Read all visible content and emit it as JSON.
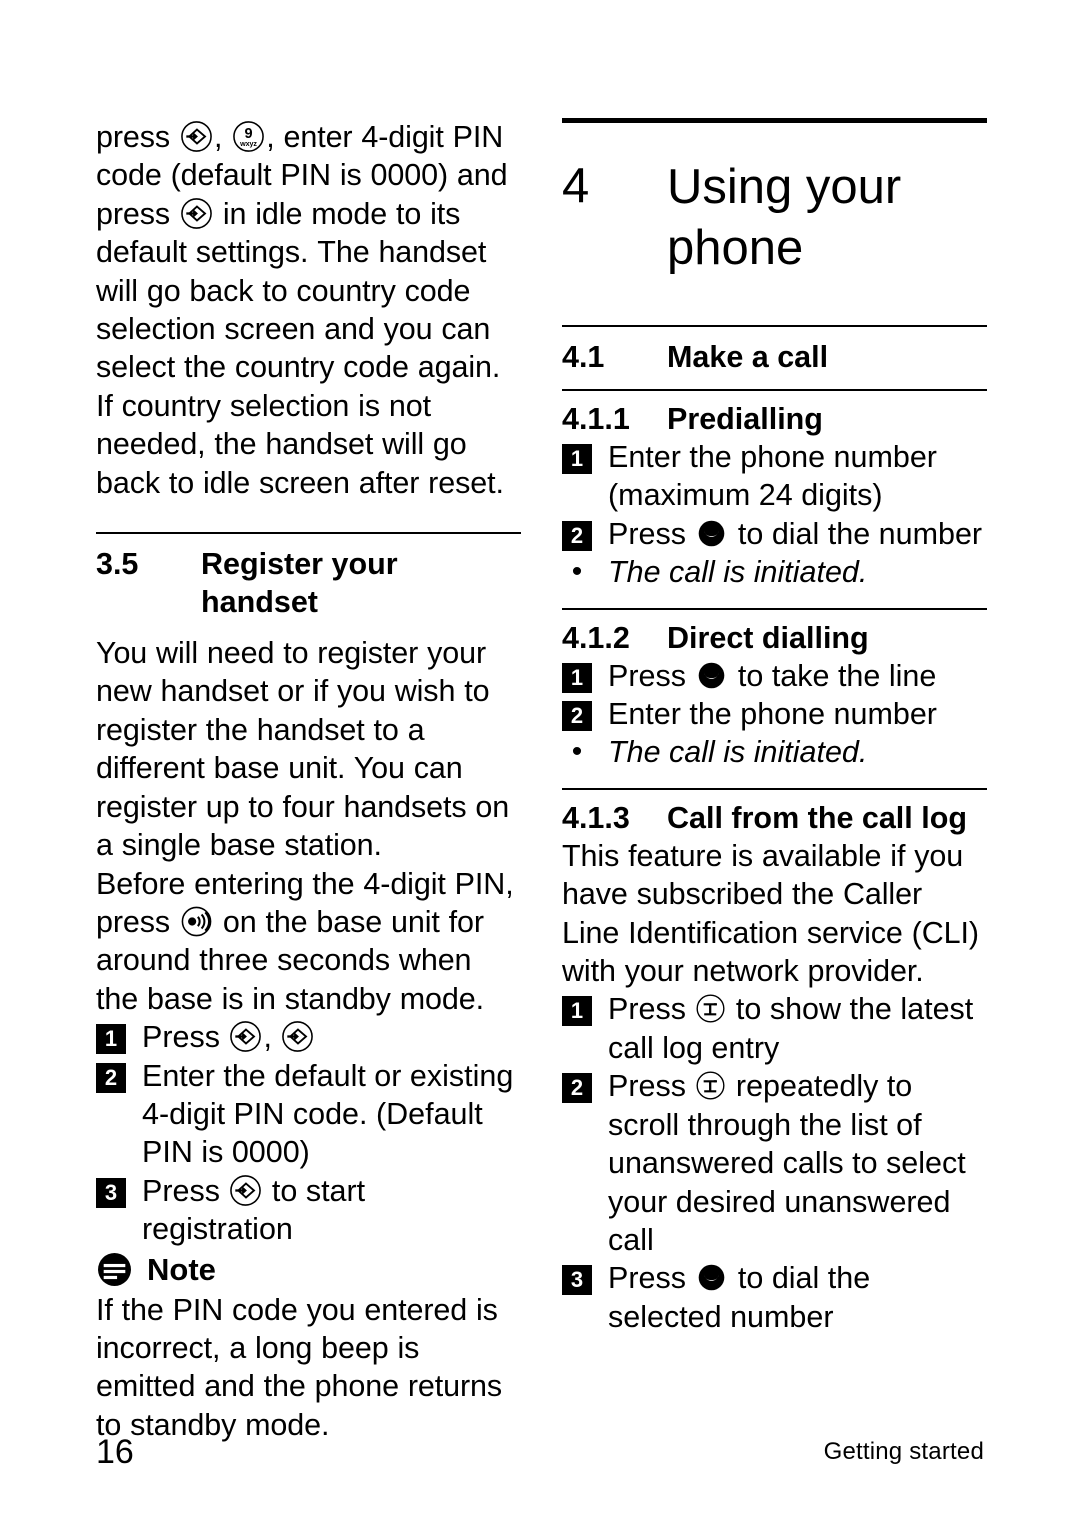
{
  "page": {
    "folio": "16",
    "running_head": "Getting started"
  },
  "left_column": {
    "continued_paragraph": "press <key:menu>, <key:nine>, enter 4-digit PIN code (default PIN is 0000) and press <key:menu> in idle mode to its default settings. The handset will go back to country code selection screen and you can select the country code again. If country selection is not needed, the handset will go back to idle screen after reset.",
    "continued_paragraph_lines": [
      "press , , enter 4-digit PIN",
      "code (default PIN is 0000) and",
      "press  in idle mode to its",
      "default settings. The handset",
      "will go back to country code",
      "selection screen and you can",
      "select the country code again. If",
      "country selection is not",
      "needed, the handset will go",
      "back to idle screen after reset."
    ],
    "section": {
      "number": "3.5",
      "title": "Register your handset",
      "paragraph_1": "You will need to register your new handset or if you wish to register the handset to a different base unit. You can register up to four handsets on a single base station.",
      "paragraph_2_before": "Before entering the 4-digit PIN, press ",
      "paragraph_2_after": " on the base unit for around three seconds when the base is in standby mode.",
      "steps": [
        {
          "num": "1",
          "text_before": "Press ",
          "text_middle": ", ",
          "text_after": ""
        },
        {
          "num": "2",
          "text": "Enter the default or existing 4-digit PIN code. (Default PIN is 0000)"
        },
        {
          "num": "3",
          "text_before": "Press ",
          "text_after": " to start registration"
        }
      ],
      "note": {
        "label": "Note",
        "text": "If the PIN code you entered is incorrect, a long beep is emitted and the phone returns to standby mode."
      }
    }
  },
  "right_column": {
    "chapter": {
      "number": "4",
      "title": "Using your phone"
    },
    "section_4_1": {
      "number": "4.1",
      "title": "Make a call"
    },
    "section_4_1_1": {
      "number": "4.1.1",
      "title": "Predialling",
      "steps": [
        {
          "num": "1",
          "text": "Enter the phone number (maximum 24 digits)"
        },
        {
          "num": "2",
          "text_before": "Press ",
          "text_after": " to dial the number"
        }
      ],
      "bullet": "The call is initiated."
    },
    "section_4_1_2": {
      "number": "4.1.2",
      "title": "Direct dialling",
      "steps": [
        {
          "num": "1",
          "text_before": "Press ",
          "text_after": " to take the line"
        },
        {
          "num": "2",
          "text": "Enter the phone number"
        }
      ],
      "bullet": "The call is initiated."
    },
    "section_4_1_3": {
      "number": "4.1.3",
      "title": "Call from the call log",
      "intro": "This feature is available if you have subscribed the Caller Line Identification service (CLI) with your network provider.",
      "steps": [
        {
          "num": "1",
          "text_before": "Press ",
          "text_after": " to show the latest call log entry"
        },
        {
          "num": "2",
          "text_before": "Press ",
          "text_after": " repeatedly to scroll through the list of unanswered calls to select your desired unanswered call"
        },
        {
          "num": "3",
          "text_before": "Press ",
          "text_after": " to dial the selected number"
        }
      ]
    }
  },
  "icons": {
    "menu_key": "menu-ok-key-icon",
    "nine_key": "keypad-nine-wxyz-key-icon",
    "paging_key": "paging-key-icon",
    "talk_key": "talk-call-key-icon",
    "call_log_key": "call-log-key-icon",
    "note_badge": "note-badge-icon"
  },
  "colors": {
    "ink": "#000000",
    "paper": "#ffffff"
  }
}
